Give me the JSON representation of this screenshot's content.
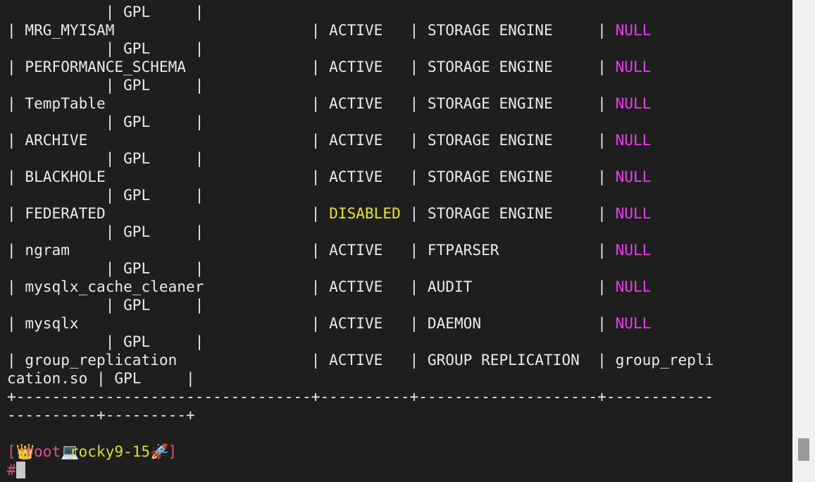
{
  "terminal": {
    "rows": [
      {
        "name": "row-cont-0",
        "parts": [
          {
            "t": "           | GPL     |"
          }
        ]
      },
      {
        "name": "row-mrg-myisam",
        "parts": [
          {
            "t": "| MRG_MYISAM                      | ACTIVE   | STORAGE ENGINE     | "
          },
          {
            "t": "NULL",
            "c": "magenta"
          }
        ]
      },
      {
        "name": "row-cont-1",
        "parts": [
          {
            "t": "           | GPL     |"
          }
        ]
      },
      {
        "name": "row-performance-schema",
        "parts": [
          {
            "t": "| PERFORMANCE_SCHEMA              | ACTIVE   | STORAGE ENGINE     | "
          },
          {
            "t": "NULL",
            "c": "magenta"
          }
        ]
      },
      {
        "name": "row-cont-2",
        "parts": [
          {
            "t": "           | GPL     |"
          }
        ]
      },
      {
        "name": "row-temptable",
        "parts": [
          {
            "t": "| TempTable                       | ACTIVE   | STORAGE ENGINE     | "
          },
          {
            "t": "NULL",
            "c": "magenta"
          }
        ]
      },
      {
        "name": "row-cont-3",
        "parts": [
          {
            "t": "           | GPL     |"
          }
        ]
      },
      {
        "name": "row-archive",
        "parts": [
          {
            "t": "| ARCHIVE                         | ACTIVE   | STORAGE ENGINE     | "
          },
          {
            "t": "NULL",
            "c": "magenta"
          }
        ]
      },
      {
        "name": "row-cont-4",
        "parts": [
          {
            "t": "           | GPL     |"
          }
        ]
      },
      {
        "name": "row-blackhole",
        "parts": [
          {
            "t": "| BLACKHOLE                       | ACTIVE   | STORAGE ENGINE     | "
          },
          {
            "t": "NULL",
            "c": "magenta"
          }
        ]
      },
      {
        "name": "row-cont-5",
        "parts": [
          {
            "t": "           | GPL     |"
          }
        ]
      },
      {
        "name": "row-federated",
        "parts": [
          {
            "t": "| FEDERATED                       | "
          },
          {
            "t": "DISABLED",
            "c": "yellow"
          },
          {
            "t": " | STORAGE ENGINE     | "
          },
          {
            "t": "NULL",
            "c": "magenta"
          }
        ]
      },
      {
        "name": "row-cont-6",
        "parts": [
          {
            "t": "           | GPL     |"
          }
        ]
      },
      {
        "name": "row-ngram",
        "parts": [
          {
            "t": "| ngram                           | ACTIVE   | FTPARSER           | "
          },
          {
            "t": "NULL",
            "c": "magenta"
          }
        ]
      },
      {
        "name": "row-cont-7",
        "parts": [
          {
            "t": "           | GPL     |"
          }
        ]
      },
      {
        "name": "row-mysqlx-cache-cleaner",
        "parts": [
          {
            "t": "| mysqlx_cache_cleaner            | ACTIVE   | AUDIT              | "
          },
          {
            "t": "NULL",
            "c": "magenta"
          }
        ]
      },
      {
        "name": "row-cont-8",
        "parts": [
          {
            "t": "           | GPL     |"
          }
        ]
      },
      {
        "name": "row-mysqlx",
        "parts": [
          {
            "t": "| mysqlx                          | ACTIVE   | DAEMON             | "
          },
          {
            "t": "NULL",
            "c": "magenta"
          }
        ]
      },
      {
        "name": "row-cont-9",
        "parts": [
          {
            "t": "           | GPL     |"
          }
        ]
      },
      {
        "name": "row-group-replication",
        "parts": [
          {
            "t": "| group_replication               | ACTIVE   | GROUP REPLICATION  | group_repli"
          }
        ]
      },
      {
        "name": "row-cont-10",
        "parts": [
          {
            "t": "cation.so | GPL     |"
          }
        ]
      },
      {
        "name": "table-border",
        "parts": [
          {
            "t": "+---------------------------------+----------+--------------------+------------"
          }
        ]
      },
      {
        "name": "table-border-cont",
        "parts": [
          {
            "t": "----------+---------+"
          }
        ]
      },
      {
        "name": "blank-line",
        "parts": [
          {
            "t": ""
          }
        ]
      }
    ],
    "prompt": {
      "open_bracket": "[",
      "crown_icon": "👑",
      "user": "root",
      "computer_icon": "💻",
      "host": "rocky9-15",
      "rocket_icon": "🚀",
      "cwd": "~",
      "close_bracket": "]",
      "symbol": "#"
    }
  },
  "colors": {
    "background": "#1e1e1e",
    "text": "#eaeaea",
    "disabled_status": "#e7e13a",
    "null_value": "#e83ee8",
    "prompt_pink": "#e04d8e",
    "prompt_host": "#dada3c",
    "prompt_cwd": "#4fa8ff",
    "scrollbar_track": "#f0f0f0",
    "scrollbar_thumb": "#9a9a9a"
  }
}
